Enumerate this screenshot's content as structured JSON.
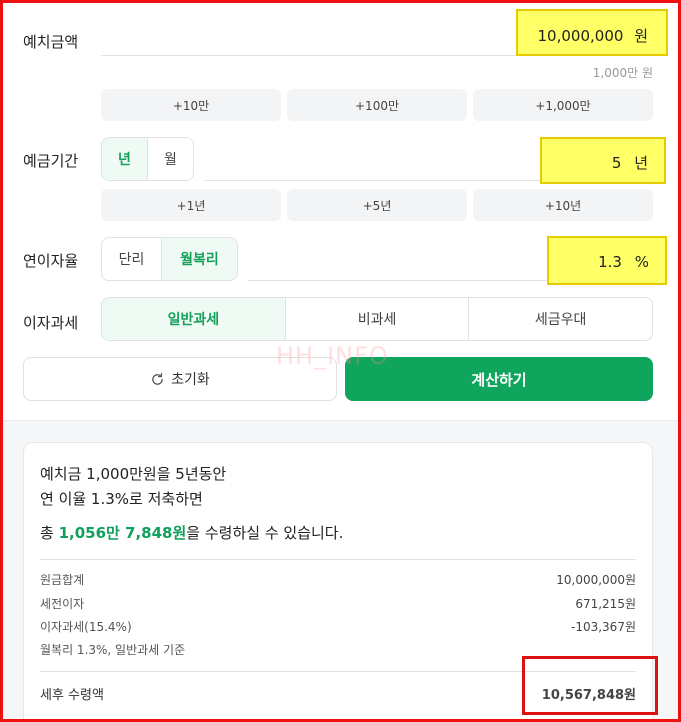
{
  "deposit": {
    "label": "예치금액",
    "value": "10,000,000",
    "unit": "원",
    "hint": "1,000만 원",
    "chips": [
      "+10만",
      "+100만",
      "+1,000만"
    ]
  },
  "period": {
    "label": "예금기간",
    "toggle": [
      "년",
      "월"
    ],
    "value": "5",
    "unit": "년",
    "chips": [
      "+1년",
      "+5년",
      "+10년"
    ]
  },
  "rate": {
    "label": "연이자율",
    "toggle": [
      "단리",
      "월복리"
    ],
    "value": "1.3",
    "unit": "%"
  },
  "tax": {
    "label": "이자과세",
    "options": [
      "일반과세",
      "비과세",
      "세금우대"
    ]
  },
  "actions": {
    "reset_label": "초기화",
    "calc_label": "계산하기"
  },
  "watermark": "HH_INFO",
  "result": {
    "line1": "예치금 1,000만원을 5년동안",
    "line2": "연 이율 1.3%로 저축하면",
    "line3_pre": "총 ",
    "line3_amount": "1,056만 7,848원",
    "line3_post": "을 수령하실 수 있습니다.",
    "rows": [
      {
        "label": "원금합계",
        "value": "10,000,000원"
      },
      {
        "label": "세전이자",
        "value": "671,215원"
      },
      {
        "label": "이자과세(15.4%)",
        "value": "-103,367원"
      }
    ],
    "note": "월복리 1.3%, 일반과세 기준",
    "final_label": "세후 수령액",
    "final_value": "10,567,848원"
  },
  "colors": {
    "accent": "#0fa55c",
    "highlight": "#ffff66",
    "annotation": "#dd1111"
  }
}
